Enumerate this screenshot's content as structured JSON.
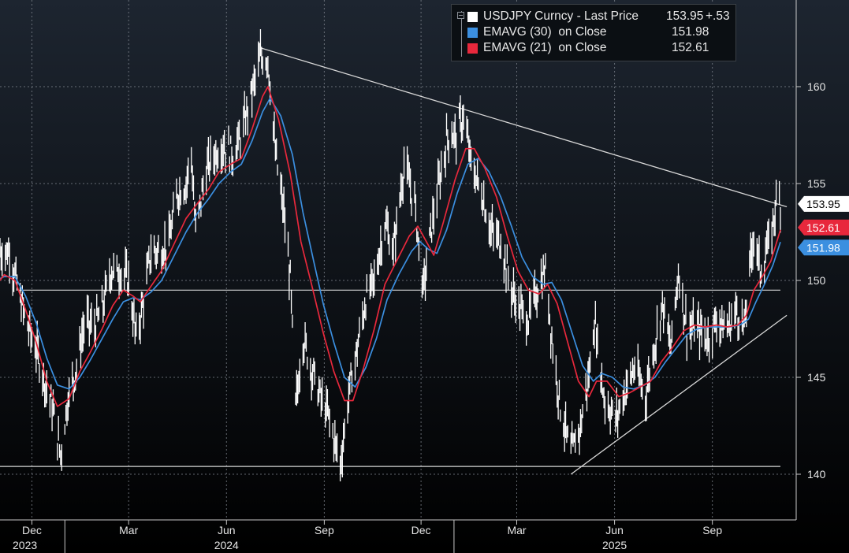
{
  "legend": {
    "title": "USDJPY Curncy - Last Price",
    "last": "153.95",
    "change": "+.53",
    "ema30_label": "EMAVG (30)  on Close",
    "ema30_value": "151.98",
    "ema21_label": "EMAVG (21)  on Close",
    "ema21_value": "152.61"
  },
  "colors": {
    "background_top": "#1d2530",
    "background_bottom": "#000000",
    "price": "#ffffff",
    "ema30": "#3b8fe0",
    "ema21": "#e8283c",
    "grid": "#8a9099",
    "trendline": "#d8d8d8"
  },
  "chart_data": {
    "type": "line",
    "title": "USDJPY Curncy - Last Price",
    "ylim": [
      137.5,
      163.5
    ],
    "y_ticks": [
      140,
      145,
      150,
      155,
      160
    ],
    "x_tick_labels": [
      "Dec",
      "Mar",
      "Jun",
      "Sep",
      "Dec",
      "Mar",
      "Jun",
      "Sep"
    ],
    "x_tick_dates": [
      "2023-12-01",
      "2024-03-01",
      "2024-06-01",
      "2024-09-01",
      "2024-12-01",
      "2025-03-01",
      "2025-06-01",
      "2025-09-01"
    ],
    "year_labels": [
      {
        "label": "2023",
        "date": "2023-11-01"
      },
      {
        "label": "2024",
        "date": "2024-06-01"
      },
      {
        "label": "2025",
        "date": "2025-06-01"
      }
    ],
    "x_range": [
      "2023-11-01",
      "2025-11-04"
    ],
    "price_series": {
      "name": "USDJPY Curncy - Last Price",
      "points": [
        [
          "2023-11-01",
          151.5
        ],
        [
          "2023-11-10",
          151.5
        ],
        [
          "2023-11-20",
          149.0
        ],
        [
          "2023-11-28",
          147.5
        ],
        [
          "2023-12-05",
          146.5
        ],
        [
          "2023-12-12",
          145.0
        ],
        [
          "2023-12-20",
          143.5
        ],
        [
          "2023-12-28",
          141.0
        ],
        [
          "2024-01-04",
          144.0
        ],
        [
          "2024-01-12",
          145.5
        ],
        [
          "2024-01-20",
          148.0
        ],
        [
          "2024-01-28",
          147.5
        ],
        [
          "2024-02-05",
          148.5
        ],
        [
          "2024-02-13",
          150.5
        ],
        [
          "2024-02-22",
          150.5
        ],
        [
          "2024-03-01",
          150.0
        ],
        [
          "2024-03-08",
          147.0
        ],
        [
          "2024-03-15",
          149.0
        ],
        [
          "2024-03-22",
          151.5
        ],
        [
          "2024-03-30",
          151.5
        ],
        [
          "2024-04-08",
          152.0
        ],
        [
          "2024-04-16",
          154.5
        ],
        [
          "2024-04-24",
          155.0
        ],
        [
          "2024-04-29",
          156.5
        ],
        [
          "2024-05-03",
          152.5
        ],
        [
          "2024-05-12",
          155.5
        ],
        [
          "2024-05-20",
          156.5
        ],
        [
          "2024-05-29",
          157.0
        ],
        [
          "2024-06-07",
          156.5
        ],
        [
          "2024-06-15",
          157.5
        ],
        [
          "2024-06-24",
          159.5
        ],
        [
          "2024-07-03",
          161.5
        ],
        [
          "2024-07-10",
          161.5
        ],
        [
          "2024-07-17",
          156.5
        ],
        [
          "2024-07-25",
          153.5
        ],
        [
          "2024-07-31",
          150.0
        ],
        [
          "2024-08-05",
          143.5
        ],
        [
          "2024-08-12",
          147.0
        ],
        [
          "2024-08-20",
          145.5
        ],
        [
          "2024-08-28",
          144.0
        ],
        [
          "2024-09-05",
          143.0
        ],
        [
          "2024-09-16",
          140.5
        ],
        [
          "2024-09-25",
          144.5
        ],
        [
          "2024-10-02",
          146.5
        ],
        [
          "2024-10-10",
          149.0
        ],
        [
          "2024-10-18",
          150.0
        ],
        [
          "2024-10-28",
          153.0
        ],
        [
          "2024-11-05",
          151.5
        ],
        [
          "2024-11-15",
          156.0
        ],
        [
          "2024-11-25",
          154.0
        ],
        [
          "2024-12-03",
          149.5
        ],
        [
          "2024-12-10",
          152.5
        ],
        [
          "2024-12-18",
          155.0
        ],
        [
          "2024-12-26",
          157.5
        ],
        [
          "2025-01-03",
          157.5
        ],
        [
          "2025-01-10",
          158.5
        ],
        [
          "2025-01-17",
          156.0
        ],
        [
          "2025-01-27",
          154.5
        ],
        [
          "2025-02-05",
          152.5
        ],
        [
          "2025-02-14",
          152.0
        ],
        [
          "2025-02-24",
          149.5
        ],
        [
          "2025-03-04",
          148.5
        ],
        [
          "2025-03-12",
          148.0
        ],
        [
          "2025-03-20",
          149.5
        ],
        [
          "2025-03-28",
          150.5
        ],
        [
          "2025-04-04",
          146.5
        ],
        [
          "2025-04-11",
          143.5
        ],
        [
          "2025-04-21",
          141.0
        ],
        [
          "2025-04-30",
          142.5
        ],
        [
          "2025-05-09",
          145.5
        ],
        [
          "2025-05-13",
          148.0
        ],
        [
          "2025-05-22",
          144.0
        ],
        [
          "2025-06-02",
          142.8
        ],
        [
          "2025-06-12",
          144.5
        ],
        [
          "2025-06-20",
          145.5
        ],
        [
          "2025-06-30",
          144.0
        ],
        [
          "2025-07-08",
          146.5
        ],
        [
          "2025-07-16",
          148.8
        ],
        [
          "2025-07-24",
          146.5
        ],
        [
          "2025-07-31",
          150.5
        ],
        [
          "2025-08-08",
          147.5
        ],
        [
          "2025-08-18",
          147.5
        ],
        [
          "2025-08-28",
          147.0
        ],
        [
          "2025-09-05",
          148.0
        ],
        [
          "2025-09-15",
          147.5
        ],
        [
          "2025-09-24",
          148.5
        ],
        [
          "2025-10-01",
          147.5
        ],
        [
          "2025-10-06",
          150.5
        ],
        [
          "2025-10-10",
          152.5
        ],
        [
          "2025-10-16",
          150.5
        ],
        [
          "2025-10-22",
          151.5
        ],
        [
          "2025-10-27",
          152.5
        ],
        [
          "2025-10-31",
          154.2
        ],
        [
          "2025-11-04",
          153.95
        ]
      ]
    },
    "ema21_series": {
      "name": "EMAVG (21)  on Close",
      "points": [
        [
          "2023-11-01",
          150.0
        ],
        [
          "2023-11-05",
          150.3
        ],
        [
          "2023-11-15",
          150.0
        ],
        [
          "2023-11-25",
          148.5
        ],
        [
          "2023-12-05",
          146.8
        ],
        [
          "2023-12-15",
          144.8
        ],
        [
          "2023-12-25",
          143.5
        ],
        [
          "2024-01-05",
          143.9
        ],
        [
          "2024-01-15",
          145.3
        ],
        [
          "2024-01-25",
          146.3
        ],
        [
          "2024-02-05",
          147.5
        ],
        [
          "2024-02-15",
          148.7
        ],
        [
          "2024-02-25",
          149.5
        ],
        [
          "2024-03-05",
          149.2
        ],
        [
          "2024-03-12",
          148.9
        ],
        [
          "2024-03-22",
          149.7
        ],
        [
          "2024-04-01",
          150.5
        ],
        [
          "2024-04-12",
          151.8
        ],
        [
          "2024-04-24",
          153.2
        ],
        [
          "2024-05-05",
          154.0
        ],
        [
          "2024-05-15",
          154.7
        ],
        [
          "2024-05-25",
          155.6
        ],
        [
          "2024-06-05",
          156.0
        ],
        [
          "2024-06-15",
          156.3
        ],
        [
          "2024-06-25",
          157.8
        ],
        [
          "2024-07-05",
          159.5
        ],
        [
          "2024-07-10",
          160.0
        ],
        [
          "2024-07-20",
          158.3
        ],
        [
          "2024-07-31",
          155.5
        ],
        [
          "2024-08-10",
          152.0
        ],
        [
          "2024-08-20",
          149.8
        ],
        [
          "2024-08-31",
          147.3
        ],
        [
          "2024-09-10",
          145.3
        ],
        [
          "2024-09-20",
          143.8
        ],
        [
          "2024-09-28",
          143.8
        ],
        [
          "2024-10-08",
          145.5
        ],
        [
          "2024-10-18",
          147.5
        ],
        [
          "2024-10-28",
          149.8
        ],
        [
          "2024-11-08",
          151.0
        ],
        [
          "2024-11-20",
          152.3
        ],
        [
          "2024-11-28",
          152.8
        ],
        [
          "2024-12-06",
          152.0
        ],
        [
          "2024-12-13",
          151.3
        ],
        [
          "2024-12-22",
          153.0
        ],
        [
          "2025-01-02",
          155.2
        ],
        [
          "2025-01-12",
          156.8
        ],
        [
          "2025-01-20",
          156.8
        ],
        [
          "2025-01-30",
          155.8
        ],
        [
          "2025-02-10",
          154.3
        ],
        [
          "2025-02-20",
          152.3
        ],
        [
          "2025-03-02",
          150.5
        ],
        [
          "2025-03-12",
          149.5
        ],
        [
          "2025-03-22",
          149.3
        ],
        [
          "2025-03-30",
          149.8
        ],
        [
          "2025-04-08",
          148.8
        ],
        [
          "2025-04-18",
          146.8
        ],
        [
          "2025-04-28",
          144.8
        ],
        [
          "2025-05-08",
          144.0
        ],
        [
          "2025-05-15",
          144.8
        ],
        [
          "2025-05-25",
          144.8
        ],
        [
          "2025-06-05",
          144.0
        ],
        [
          "2025-06-15",
          144.2
        ],
        [
          "2025-06-25",
          144.5
        ],
        [
          "2025-07-05",
          144.8
        ],
        [
          "2025-07-15",
          145.8
        ],
        [
          "2025-07-25",
          146.5
        ],
        [
          "2025-08-05",
          147.4
        ],
        [
          "2025-08-15",
          147.7
        ],
        [
          "2025-08-25",
          147.6
        ],
        [
          "2025-09-05",
          147.7
        ],
        [
          "2025-09-15",
          147.6
        ],
        [
          "2025-09-25",
          147.7
        ],
        [
          "2025-10-03",
          148.2
        ],
        [
          "2025-10-10",
          149.5
        ],
        [
          "2025-10-18",
          150.2
        ],
        [
          "2025-10-26",
          151.0
        ],
        [
          "2025-11-04",
          152.61
        ]
      ]
    },
    "ema30_series": {
      "name": "EMAVG (30)  on Close",
      "points": [
        [
          "2023-11-01",
          150.1
        ],
        [
          "2023-11-05",
          150.2
        ],
        [
          "2023-11-15",
          150.2
        ],
        [
          "2023-11-25",
          149.2
        ],
        [
          "2023-12-05",
          147.8
        ],
        [
          "2023-12-15",
          146.0
        ],
        [
          "2023-12-25",
          144.6
        ],
        [
          "2024-01-05",
          144.4
        ],
        [
          "2024-01-15",
          145.0
        ],
        [
          "2024-01-25",
          145.9
        ],
        [
          "2024-02-05",
          147.0
        ],
        [
          "2024-02-15",
          148.0
        ],
        [
          "2024-02-25",
          148.9
        ],
        [
          "2024-03-05",
          149.1
        ],
        [
          "2024-03-12",
          149.0
        ],
        [
          "2024-03-22",
          149.4
        ],
        [
          "2024-04-01",
          150.0
        ],
        [
          "2024-04-12",
          151.2
        ],
        [
          "2024-04-24",
          152.5
        ],
        [
          "2024-05-05",
          153.5
        ],
        [
          "2024-05-15",
          154.2
        ],
        [
          "2024-05-25",
          155.0
        ],
        [
          "2024-06-05",
          155.6
        ],
        [
          "2024-06-15",
          156.0
        ],
        [
          "2024-06-25",
          157.2
        ],
        [
          "2024-07-05",
          158.7
        ],
        [
          "2024-07-12",
          159.4
        ],
        [
          "2024-07-22",
          158.5
        ],
        [
          "2024-08-02",
          156.5
        ],
        [
          "2024-08-12",
          153.5
        ],
        [
          "2024-08-22",
          151.0
        ],
        [
          "2024-08-31",
          148.8
        ],
        [
          "2024-09-10",
          146.8
        ],
        [
          "2024-09-20",
          145.0
        ],
        [
          "2024-09-30",
          144.5
        ],
        [
          "2024-10-10",
          145.5
        ],
        [
          "2024-10-20",
          147.0
        ],
        [
          "2024-10-30",
          149.0
        ],
        [
          "2024-11-10",
          150.3
        ],
        [
          "2024-11-22",
          151.5
        ],
        [
          "2024-11-30",
          152.0
        ],
        [
          "2024-12-08",
          151.6
        ],
        [
          "2024-12-16",
          151.4
        ],
        [
          "2024-12-25",
          152.6
        ],
        [
          "2025-01-04",
          154.5
        ],
        [
          "2025-01-14",
          156.0
        ],
        [
          "2025-01-24",
          156.3
        ],
        [
          "2025-02-03",
          155.6
        ],
        [
          "2025-02-14",
          154.3
        ],
        [
          "2025-02-24",
          152.8
        ],
        [
          "2025-03-06",
          151.2
        ],
        [
          "2025-03-16",
          150.2
        ],
        [
          "2025-03-26",
          149.8
        ],
        [
          "2025-04-03",
          149.9
        ],
        [
          "2025-04-12",
          149.0
        ],
        [
          "2025-04-22",
          147.3
        ],
        [
          "2025-05-02",
          145.6
        ],
        [
          "2025-05-12",
          144.8
        ],
        [
          "2025-05-20",
          145.2
        ],
        [
          "2025-05-30",
          145.0
        ],
        [
          "2025-06-09",
          144.5
        ],
        [
          "2025-06-19",
          144.4
        ],
        [
          "2025-06-29",
          144.6
        ],
        [
          "2025-07-09",
          145.0
        ],
        [
          "2025-07-19",
          145.8
        ],
        [
          "2025-07-29",
          146.5
        ],
        [
          "2025-08-08",
          147.2
        ],
        [
          "2025-08-18",
          147.5
        ],
        [
          "2025-08-28",
          147.6
        ],
        [
          "2025-09-07",
          147.6
        ],
        [
          "2025-09-17",
          147.6
        ],
        [
          "2025-09-27",
          147.7
        ],
        [
          "2025-10-05",
          148.0
        ],
        [
          "2025-10-12",
          148.9
        ],
        [
          "2025-10-20",
          149.8
        ],
        [
          "2025-10-28",
          150.8
        ],
        [
          "2025-11-04",
          151.98
        ]
      ]
    },
    "trendlines": [
      {
        "from": [
          "2024-07-03",
          162.0
        ],
        "to": [
          "2025-11-10",
          153.8
        ]
      },
      {
        "from": [
          "2025-04-21",
          140.0
        ],
        "to": [
          "2025-11-10",
          148.2
        ]
      }
    ],
    "horizontal_lines": [
      {
        "y": 149.5,
        "from": "2023-11-19",
        "to": "2025-11-04"
      },
      {
        "y": 140.4,
        "from": "2023-11-01",
        "to": "2025-11-04"
      }
    ],
    "price_labels": [
      {
        "value": "153.95",
        "y": 153.95,
        "fill": "#ffffff",
        "text": "#000000"
      },
      {
        "value": "152.61",
        "y": 152.61,
        "fill": "#e8283c",
        "text": "#ffffff"
      },
      {
        "value": "151.98",
        "y": 151.98,
        "fill": "#3b8fe0",
        "text": "#ffffff"
      }
    ]
  }
}
